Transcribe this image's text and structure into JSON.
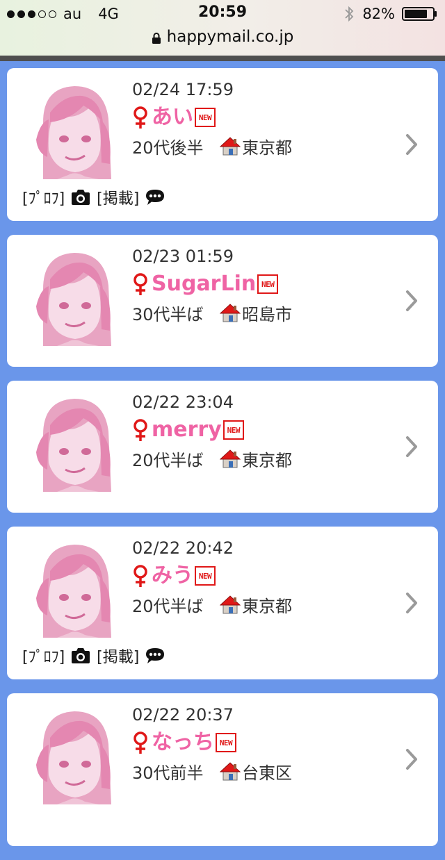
{
  "status_bar": {
    "carrier": "au",
    "network": "4G",
    "time": "20:59",
    "battery": "82%",
    "url": "happymail.co.jp",
    "signal_bars_filled": 3,
    "signal_bars_total": 5
  },
  "colors": {
    "background": "#6a96ea",
    "name_pink": "#ef63a4",
    "female_red": "#e01818"
  },
  "labels": {
    "profile": "[ﾌﾟﾛﾌ]",
    "posting": "[掲載]",
    "new_badge": "NEW"
  },
  "cards": [
    {
      "datetime": "02/24 17:59",
      "name": "あい",
      "age": "20代後半",
      "location": "東京都",
      "has_extra": true
    },
    {
      "datetime": "02/23 01:59",
      "name": "SugarLin",
      "age": "30代半ば",
      "location": "昭島市",
      "has_extra": false
    },
    {
      "datetime": "02/22 23:04",
      "name": "merry",
      "age": "20代半ば",
      "location": "東京都",
      "has_extra": false
    },
    {
      "datetime": "02/22 20:42",
      "name": "みう",
      "age": "20代半ば",
      "location": "東京都",
      "has_extra": true
    },
    {
      "datetime": "02/22 20:37",
      "name": "なっち",
      "age": "30代前半",
      "location": "台東区",
      "has_extra": false
    }
  ],
  "icons": {
    "avatar": "female-avatar-icon",
    "gender": "female-symbol-icon",
    "location": "house-icon",
    "photo": "camera-icon",
    "message": "speech-bubble-icon",
    "open": "chevron-right-icon"
  }
}
